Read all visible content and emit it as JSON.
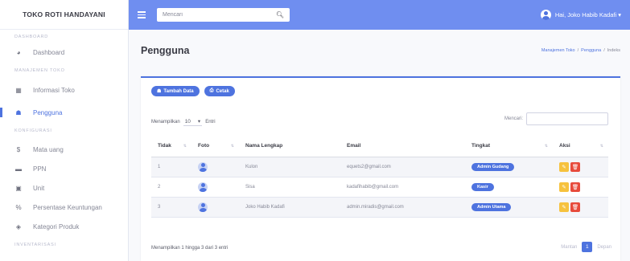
{
  "sidebar": {
    "brand": "TOKO ROTI HANDAYANI",
    "sections": [
      {
        "title": "DASHBOARD",
        "items": [
          {
            "label": "Dashboard",
            "icon": "dashboard-icon"
          }
        ]
      },
      {
        "title": "MANAJEMEN TOKO",
        "items": [
          {
            "label": "Informasi Toko",
            "icon": "store-icon"
          },
          {
            "label": "Pengguna",
            "icon": "users-icon",
            "active": true
          }
        ]
      },
      {
        "title": "KONFIGURASI",
        "items": [
          {
            "label": "Mata uang",
            "icon": "dollar-icon"
          },
          {
            "label": "PPN",
            "icon": "money-bill-icon"
          },
          {
            "label": "Unit",
            "icon": "box-icon"
          },
          {
            "label": "Persentase Keuntungan",
            "icon": "percent-icon"
          },
          {
            "label": "Kategori Produk",
            "icon": "tag-icon"
          }
        ]
      },
      {
        "title": "INVENTARISASI",
        "items": []
      }
    ]
  },
  "topbar": {
    "search_placeholder": "Mencari",
    "user_greeting": "Hai, Joko Habib Kadafi ▾"
  },
  "page": {
    "title": "Pengguna",
    "breadcrumb": [
      "Manajemen Toko",
      "/",
      "Pengguna",
      "/",
      "Indeks"
    ]
  },
  "card": {
    "add_button": "Tambah Data",
    "print_button": "Cetak",
    "length_prefix": "Menampilkan",
    "length_value": "10",
    "length_suffix": "Entri",
    "filter_label": "Mencari:",
    "columns": [
      "Tidak",
      "Foto",
      "Nama Lengkap",
      "Email",
      "Tingkat",
      "Aksi"
    ],
    "rows": [
      {
        "no": "1",
        "name": "Kulon",
        "email": "equets2@gmail.com",
        "level": "Admin Gudang"
      },
      {
        "no": "2",
        "name": "Sisa",
        "email": "kadafihabib@gmail.com",
        "level": "Kasir"
      },
      {
        "no": "3",
        "name": "Joko Habib Kadafi",
        "email": "admin.miradis@gmail.com",
        "level": "Admin Utama"
      }
    ],
    "info": "Menampilkan 1 hingga 3 dari 3 entri",
    "pager": {
      "prev": "Mantan",
      "page": "1",
      "next": "Depan"
    }
  },
  "colors": {
    "primary": "#4e73df",
    "topbar": "#6f8ef0",
    "warning": "#f6c23e",
    "danger": "#e74a3b"
  }
}
